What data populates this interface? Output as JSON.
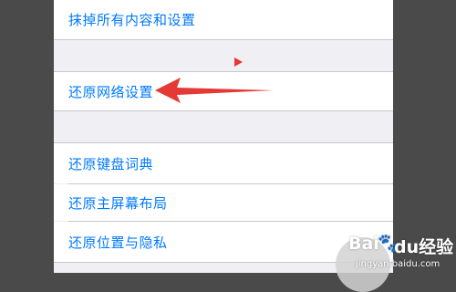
{
  "settings": {
    "erase_all_label": "抹掉所有内容和设置",
    "reset_network_label": "还原网络设置",
    "reset_keyboard_label": "还原键盘词典",
    "reset_home_label": "还原主屏幕布局",
    "reset_location_label": "还原位置与隐私"
  },
  "annotation": {
    "arrow_color": "#e53935"
  },
  "watermark": {
    "logo": "Bai",
    "logo_suffix": "du",
    "text": "经验",
    "url": "jingyan.baidu.com"
  },
  "colors": {
    "link_blue": "#007aff",
    "group_bg": "#efeff4",
    "outer_bg": "#4a4a4a"
  }
}
